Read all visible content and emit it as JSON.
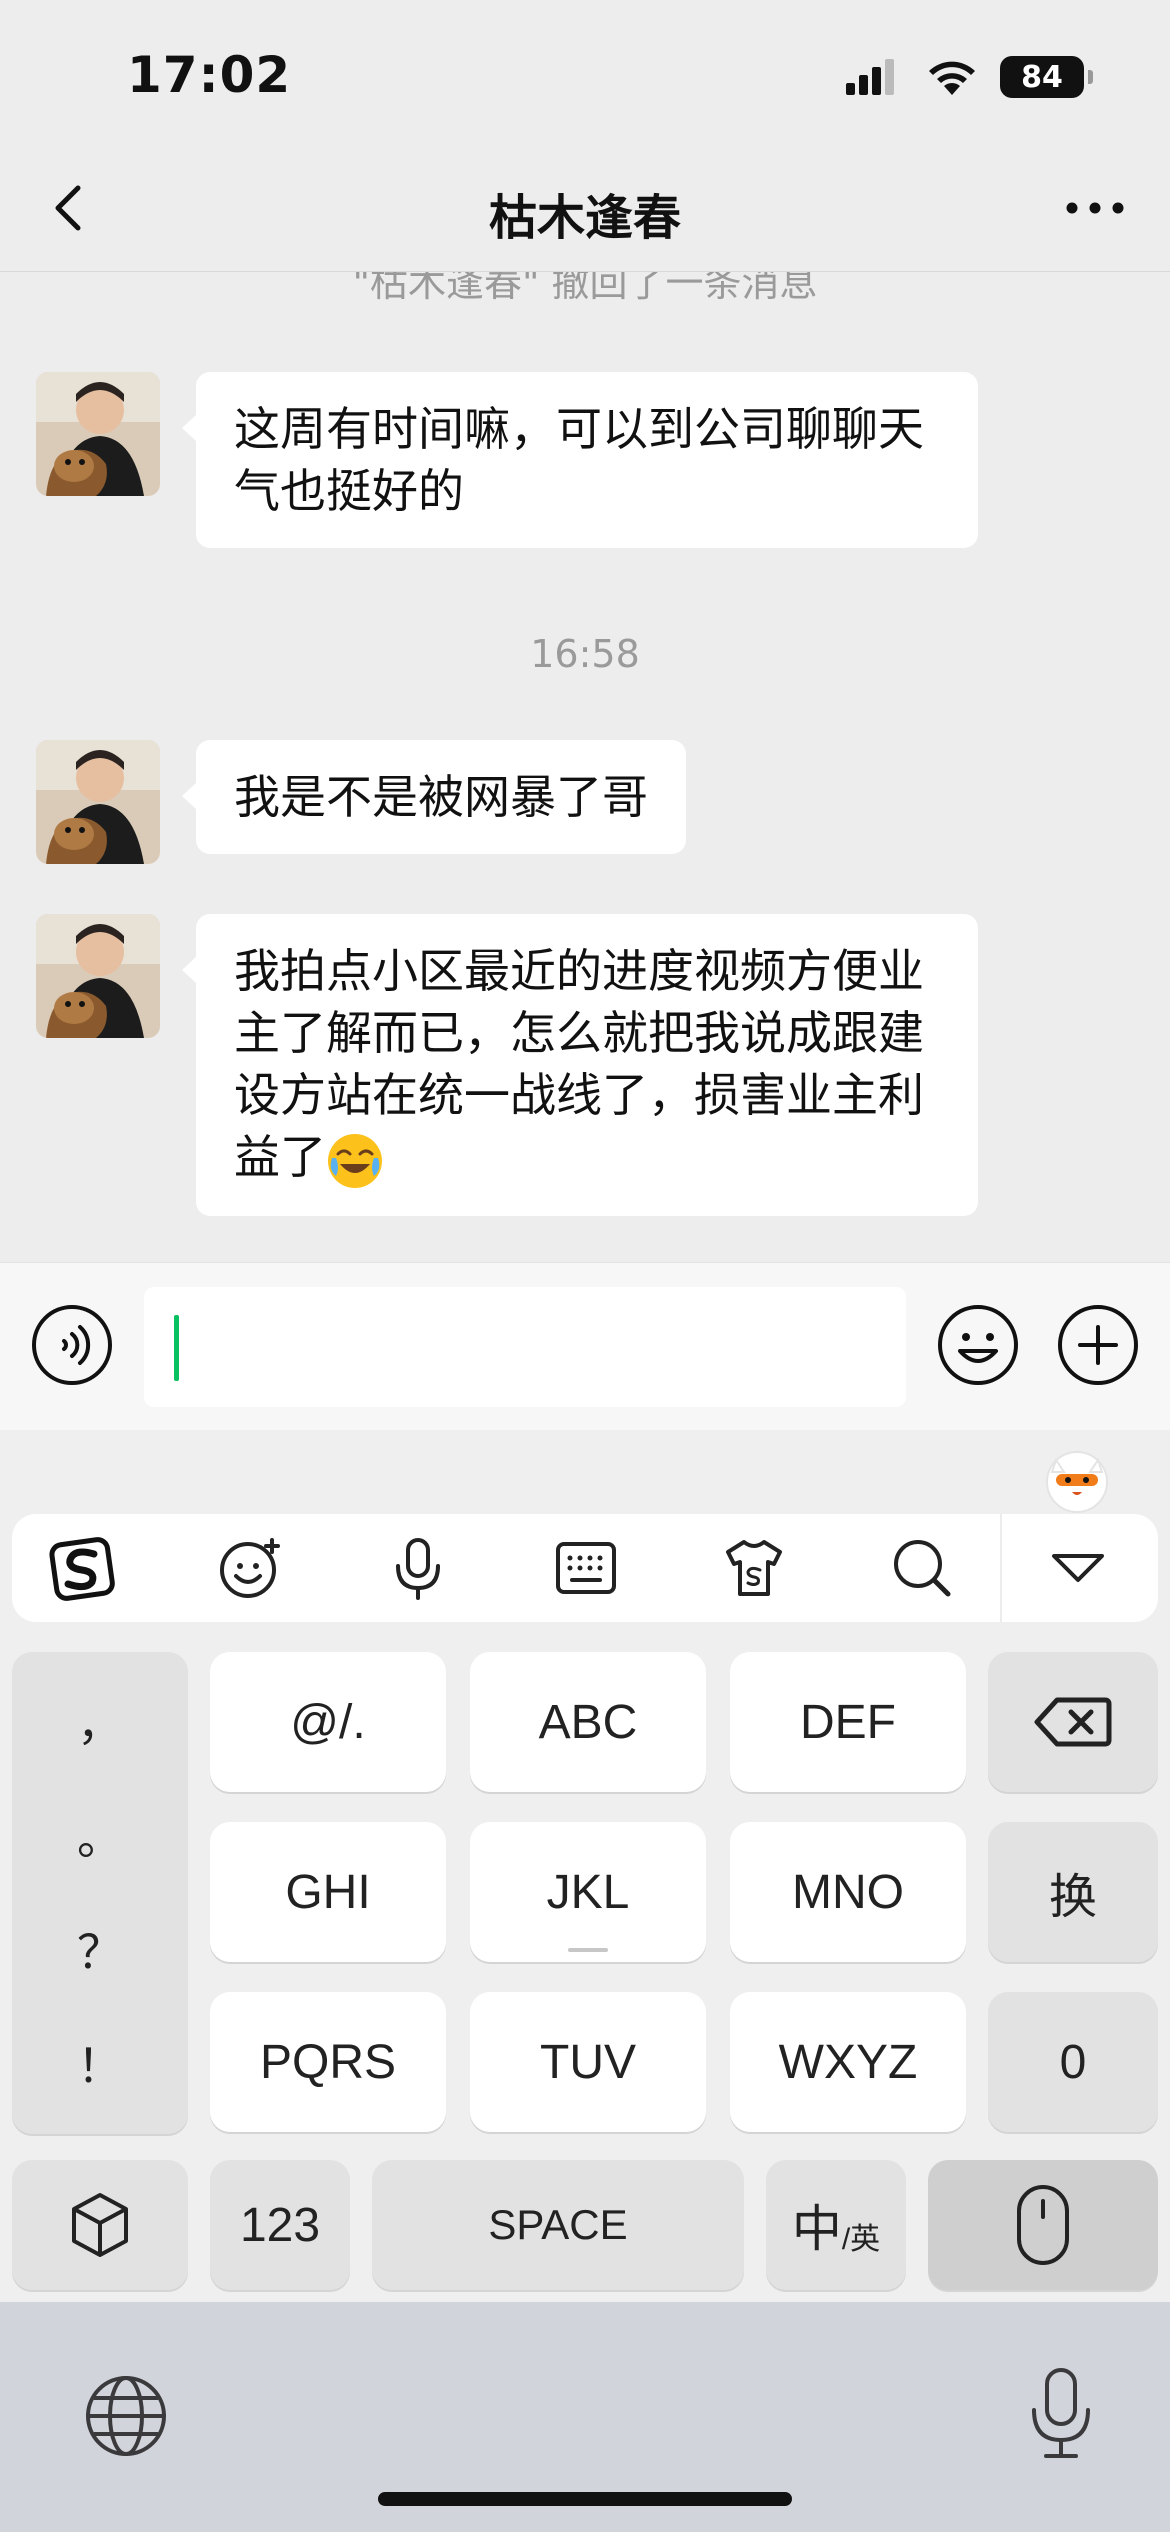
{
  "status_bar": {
    "time": "17:02",
    "battery": "84"
  },
  "nav": {
    "title": "枯木逢春"
  },
  "chat": {
    "recall_notice": "\"枯木逢春\" 撤回了一条消息",
    "timestamp": "16:58",
    "messages": [
      {
        "text": "这周有时间嘛，可以到公司聊聊天气也挺好的"
      },
      {
        "text": "我是不是被网暴了哥"
      },
      {
        "text": "我拍点小区最近的进度视频方便业主了解而已，怎么就把我说成跟建设方站在统一战线了，损害业主利益了",
        "emoji": "crying-laughing-emoji"
      }
    ]
  },
  "input": {
    "value": ""
  },
  "keyboard": {
    "punctuation": [
      "，",
      "。",
      "？",
      "！"
    ],
    "row1": [
      "@/.",
      "ABC",
      "DEF"
    ],
    "row2": [
      "GHI",
      "JKL",
      "MNO"
    ],
    "row3": [
      "PQRS",
      "TUV",
      "WXYZ"
    ],
    "switch_key": "换",
    "zero_key": "0",
    "numbers_key": "123",
    "space_key": "SPACE",
    "lang_key_main": "中",
    "lang_key_sub": "/英"
  },
  "colors": {
    "accent": "#07c160",
    "bubble": "#ffffff",
    "chat_bg": "#ededed"
  }
}
